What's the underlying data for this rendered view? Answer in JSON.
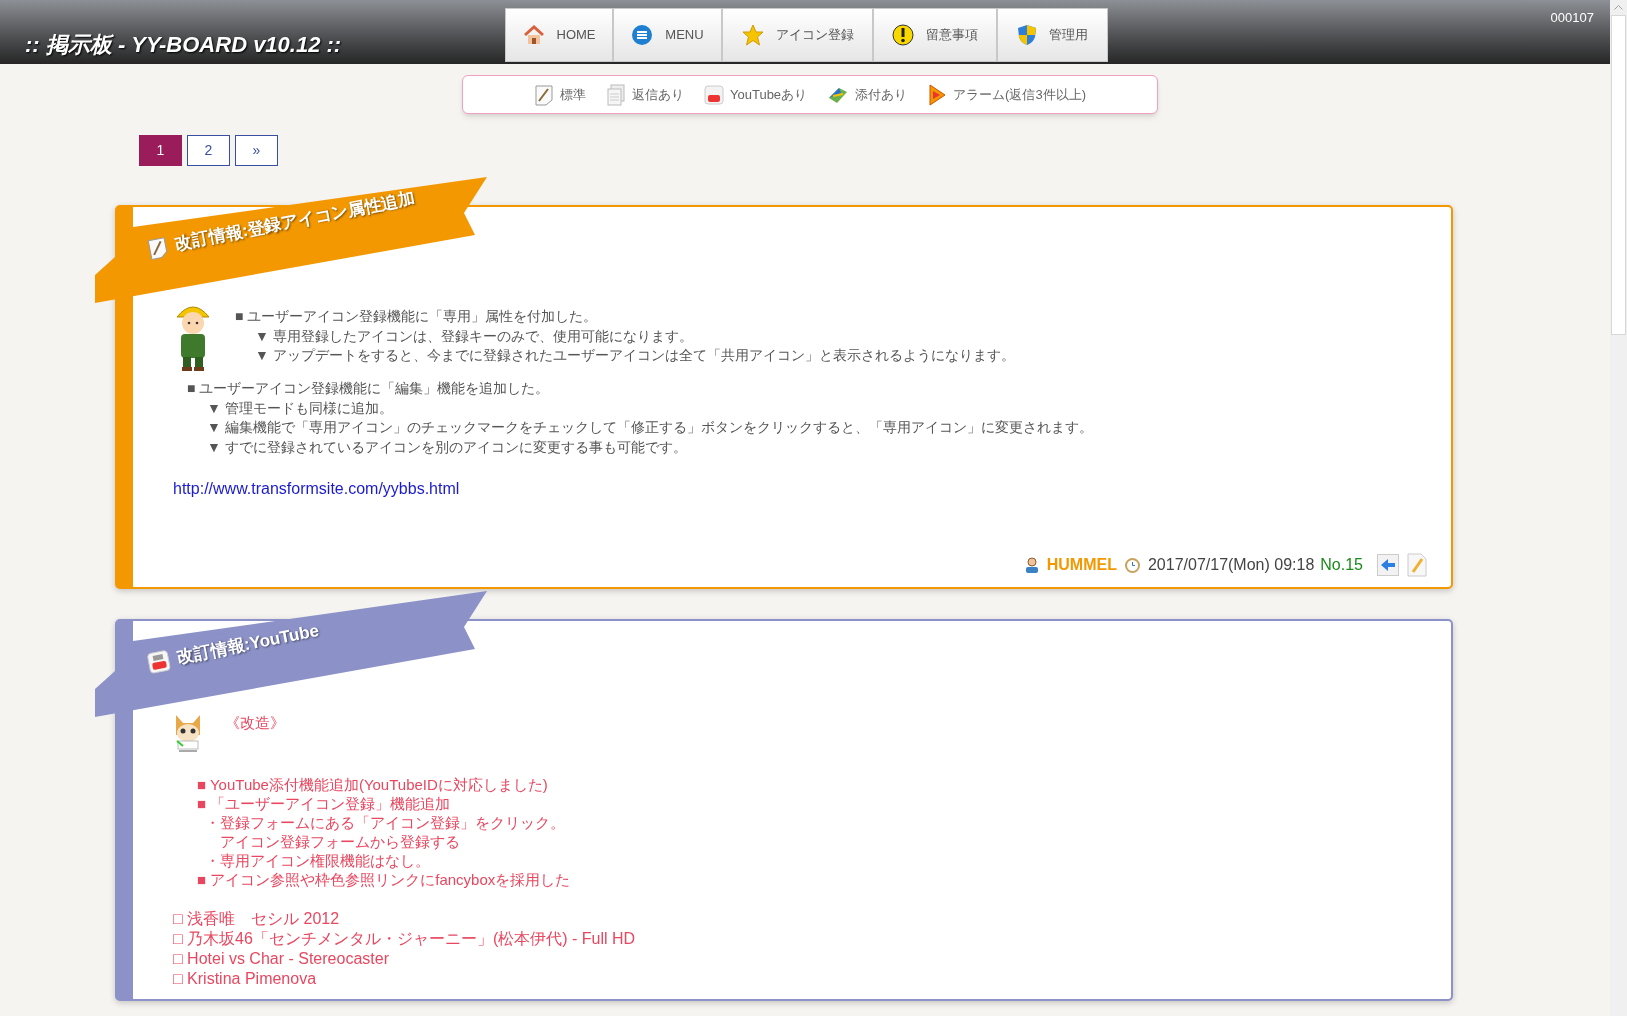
{
  "header": {
    "title": ":: 掲示板 - YY-BOARD v10.12 ::",
    "counter": "000107"
  },
  "nav": [
    {
      "label": "HOME"
    },
    {
      "label": "MENU"
    },
    {
      "label": "アイコン登録"
    },
    {
      "label": "留意事項"
    },
    {
      "label": "管理用"
    }
  ],
  "legend": [
    {
      "label": "標準"
    },
    {
      "label": "返信あり"
    },
    {
      "label": "YouTubeあり"
    },
    {
      "label": "添付あり"
    },
    {
      "label": "アラーム(返信3件以上)"
    }
  ],
  "pagination": [
    {
      "label": "1",
      "selected": true
    },
    {
      "label": "2",
      "selected": false
    },
    {
      "label": "»",
      "selected": false
    }
  ],
  "posts": [
    {
      "kind": "standard",
      "color": "#f39800",
      "title": "改訂情報:登録アイコン属性追加",
      "groups": [
        {
          "beside_avatar": true,
          "items": [
            {
              "text": "■ ユーザーアイコン登録機能に「専用」属性を付加した。",
              "children": [
                {
                  "text": "▼ 専用登録したアイコンは、登録キーのみで、使用可能になります。"
                },
                {
                  "text": "▼ アップデートをすると、今までに登録されたユーザーアイコンは全て「共用アイコン」と表示されるようになります。"
                }
              ]
            }
          ]
        },
        {
          "beside_avatar": false,
          "items": [
            {
              "text": "■ ユーザーアイコン登録機能に「編集」機能を追加した。",
              "children": [
                {
                  "text": "▼ 管理モードも同様に追加。"
                },
                {
                  "text": "▼ 編集機能で「専用アイコン」のチェックマークをチェックして「修正する」ボタンをクリックすると、「専用アイコン」に変更されます。"
                },
                {
                  "text": "▼ すでに登録されているアイコンを別のアイコンに変更する事も可能です。"
                }
              ]
            }
          ]
        }
      ],
      "url": "http://www.transformsite.com/yybbs.html",
      "footer": {
        "author": "HUMMEL",
        "date": "2017/07/17(Mon) 09:18",
        "number": "No.15"
      }
    },
    {
      "kind": "youtube",
      "color": "#8c92c8",
      "title": "改訂情報:YouTube",
      "heading": "《改造》",
      "groups": [
        {
          "beside_avatar": false,
          "items": [
            {
              "text": "■ YouTube添付機能追加(YouTubeIDに対応しました)"
            },
            {
              "text": "■ 「ユーザーアイコン登録」機能追加",
              "children": [
                {
                  "text": "・登録フォームにある「アイコン登録」をクリック。"
                },
                {
                  "text": "　アイコン登録フォームから登録する"
                },
                {
                  "text": "・専用アイコン権限機能はなし。"
                }
              ]
            },
            {
              "text": "■ アイコン参照や枠色参照リンクにfancyboxを採用した"
            }
          ]
        }
      ],
      "links": [
        "□ 浅香唯　セシル 2012",
        "□ 乃木坂46「センチメンタル・ジャーニー」(松本伊代) - Full HD",
        "□ Hotei vs Char - Stereocaster",
        "□ Kristina Pimenova"
      ]
    }
  ]
}
